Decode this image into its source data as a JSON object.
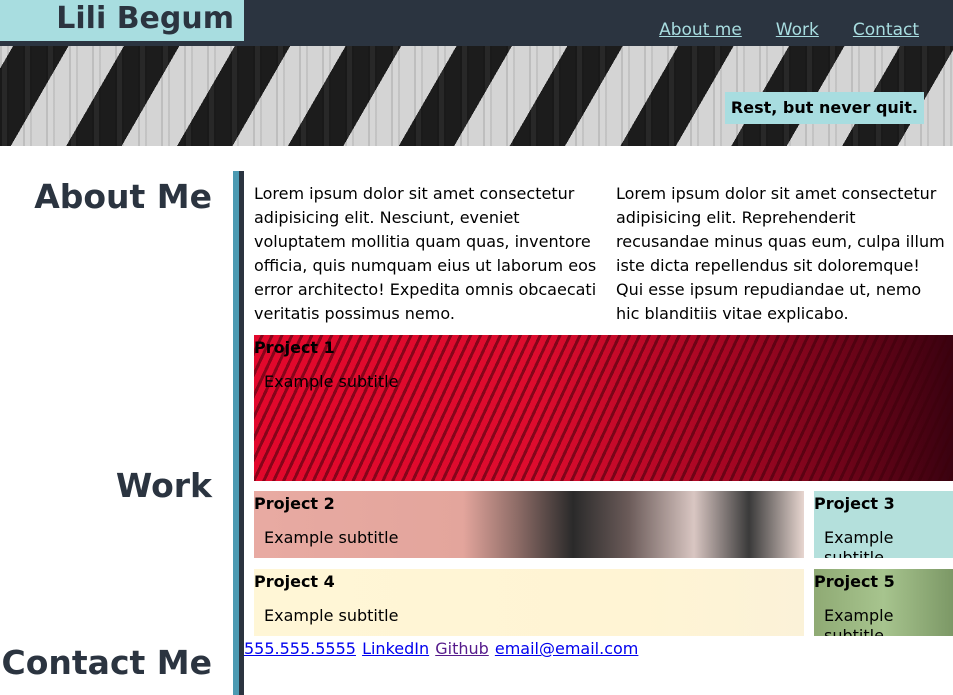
{
  "header": {
    "brand": "Lili Begum",
    "nav": [
      "About me",
      "Work",
      "Contact"
    ]
  },
  "hero": {
    "tagline": "Rest, but never quit."
  },
  "sections": {
    "about_title": "About Me",
    "work_title": "Work",
    "contact_title": "Contact Me"
  },
  "about": {
    "col1": "Lorem ipsum dolor sit amet consectetur adipisicing elit. Nesciunt, eveniet voluptatem mollitia quam quas, inventore officia, quis numquam eius ut laborum eos error architecto! Expedita omnis obcaecati veritatis possimus nemo.",
    "col2": "Lorem ipsum dolor sit amet consectetur adipisicing elit. Reprehenderit recusandae minus quas eum, culpa illum iste dicta repellendus sit doloremque! Qui esse ipsum repudiandae ut, nemo hic blanditiis vitae explicabo."
  },
  "projects": [
    {
      "title": "Project 1",
      "subtitle": "Example subtitle"
    },
    {
      "title": "Project 2",
      "subtitle": "Example subtitle"
    },
    {
      "title": "Project 3",
      "subtitle": "Example subtitle"
    },
    {
      "title": "Project 4",
      "subtitle": "Example subtitle"
    },
    {
      "title": "Project 5",
      "subtitle": "Example subtitle"
    }
  ],
  "contact": {
    "phone": "555.555.5555",
    "linkedin": "LinkedIn",
    "github": "Github",
    "email": "email@email.com"
  },
  "colors": {
    "dark": "#2b3440",
    "accent": "#a8dde0",
    "divider_blue": "#4c9ab2"
  }
}
